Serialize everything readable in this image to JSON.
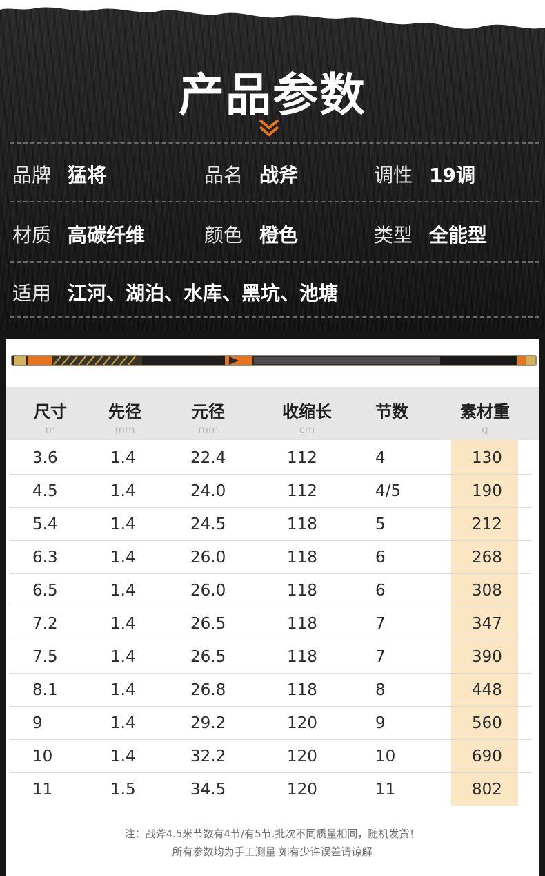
{
  "title": "产品参数",
  "properties": [
    {
      "label": "品牌",
      "value": "猛将"
    },
    {
      "label": "品名",
      "value": "战斧"
    },
    {
      "label": "调性",
      "value": "19调"
    },
    {
      "label": "材质",
      "value": "高碳纤维"
    },
    {
      "label": "颜色",
      "value": "橙色"
    },
    {
      "label": "类型",
      "value": "全能型"
    },
    {
      "label": "适用",
      "value": "江河、湖泊、水库、黑坑、池塘"
    }
  ],
  "table": {
    "headers": [
      {
        "name": "尺寸",
        "unit": "m"
      },
      {
        "name": "先径",
        "unit": "mm"
      },
      {
        "name": "元径",
        "unit": "mm"
      },
      {
        "name": "收缩长",
        "unit": "cm"
      },
      {
        "name": "节数",
        "unit": ""
      },
      {
        "name": "素材重",
        "unit": "g"
      }
    ],
    "rows": [
      [
        "3.6",
        "1.4",
        "22.4",
        "112",
        "4",
        "130"
      ],
      [
        "4.5",
        "1.4",
        "24.0",
        "112",
        "4/5",
        "190"
      ],
      [
        "5.4",
        "1.4",
        "24.5",
        "118",
        "5",
        "212"
      ],
      [
        "6.3",
        "1.4",
        "26.0",
        "118",
        "6",
        "268"
      ],
      [
        "6.5",
        "1.4",
        "26.0",
        "118",
        "6",
        "308"
      ],
      [
        "7.2",
        "1.4",
        "26.5",
        "118",
        "7",
        "347"
      ],
      [
        "7.5",
        "1.4",
        "26.5",
        "118",
        "7",
        "390"
      ],
      [
        "8.1",
        "1.4",
        "26.8",
        "118",
        "8",
        "448"
      ],
      [
        "9",
        "1.4",
        "29.2",
        "120",
        "9",
        "560"
      ],
      [
        "10",
        "1.4",
        "32.2",
        "120",
        "10",
        "690"
      ],
      [
        "11",
        "1.5",
        "34.5",
        "120",
        "11",
        "802"
      ]
    ]
  },
  "notes": [
    "注：战斧4.5米节数有4节/有5节.批次不同质量相同，随机发货！",
    "所有参数均为手工测量 如有少许误差请谅解"
  ],
  "colors": {
    "accent": "#e8731f",
    "weight_highlight": "#fbe6c3",
    "header_bg": "#e6e6e6"
  },
  "icons": [
    "double-chevron-down-icon",
    "fishing-rod-image"
  ]
}
